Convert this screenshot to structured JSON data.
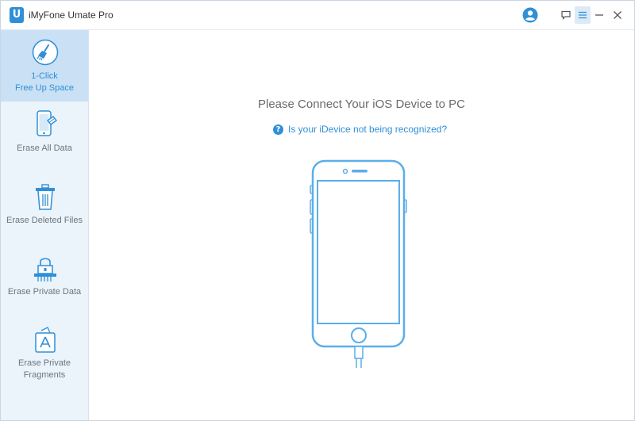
{
  "window": {
    "title": "iMyFone Umate Pro",
    "logo_letter": "U"
  },
  "sidebar": {
    "items": [
      {
        "label_line1": "1-Click",
        "label_line2": "Free Up Space",
        "icon": "broom-icon",
        "active": true
      },
      {
        "label_line1": "Erase All Data",
        "label_line2": "",
        "icon": "phone-erase-icon",
        "active": false
      },
      {
        "label_line1": "Erase Deleted Files",
        "label_line2": "",
        "icon": "trash-icon",
        "active": false
      },
      {
        "label_line1": "Erase Private Data",
        "label_line2": "",
        "icon": "lock-shredder-icon",
        "active": false
      },
      {
        "label_line1": "Erase Private",
        "label_line2": "Fragments",
        "icon": "app-fragments-icon",
        "active": false
      }
    ]
  },
  "main": {
    "heading": "Please Connect Your iOS Device to PC",
    "help_link": "Is your iDevice not being recognized?"
  },
  "colors": {
    "accent": "#2f8fd8",
    "sidebar_bg": "#ebf3fb",
    "active_bg": "#c9e0f5",
    "phone_stroke": "#5aaeea"
  }
}
